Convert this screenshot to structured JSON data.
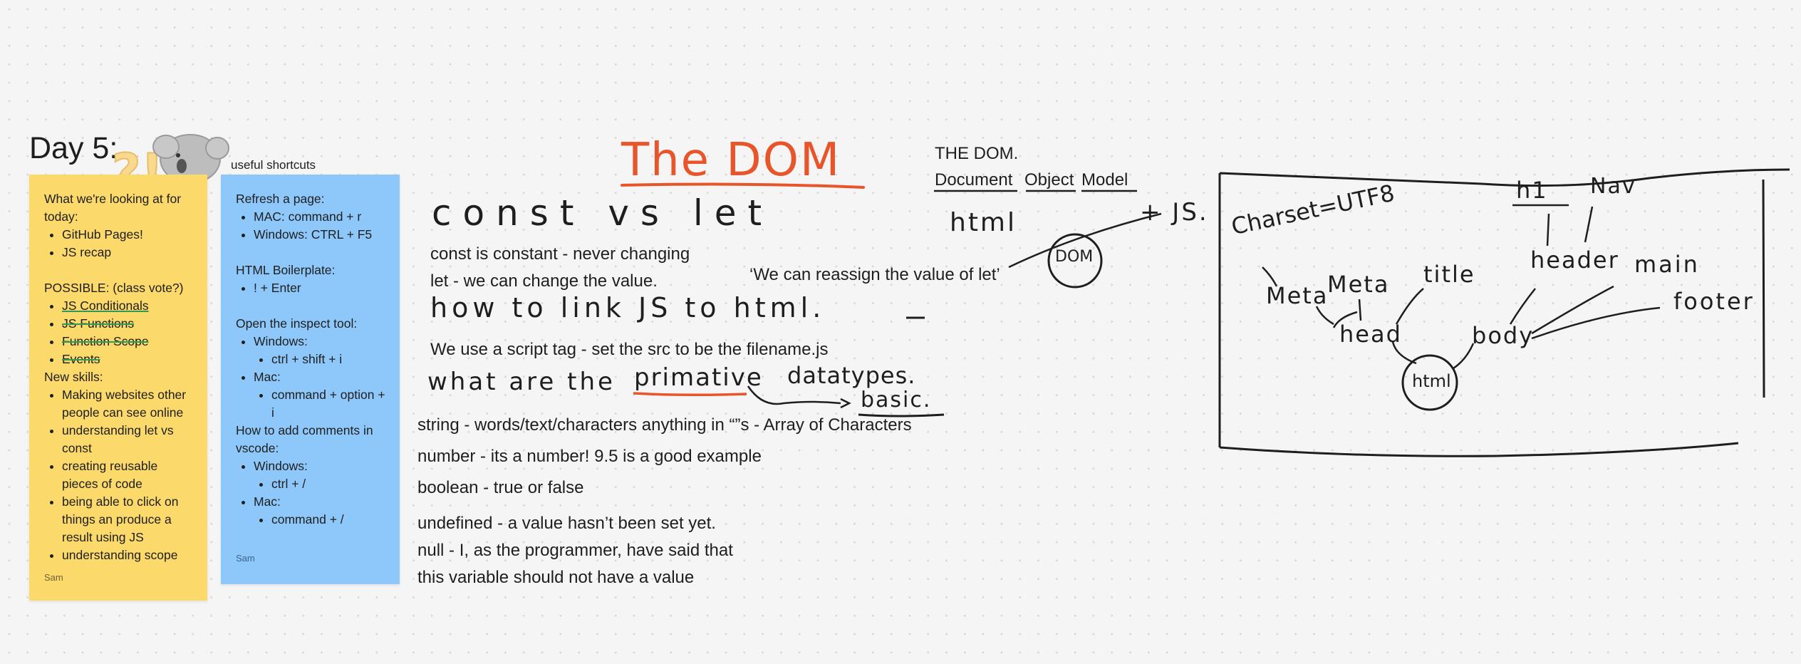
{
  "frame": {
    "title": "Day 5:"
  },
  "shortcuts_label": "useful shortcuts",
  "yellow_note": {
    "intro": "What we're looking at for today:",
    "today_items": [
      "GitHub Pages!",
      "JS recap"
    ],
    "possible_heading": "POSSIBLE: (class vote?)",
    "possible_items": [
      "JS Conditionals",
      "JS Functions",
      "Function Scope",
      "Events"
    ],
    "skills_heading": "New skills:",
    "skills_items": [
      "Making websites other people can see online",
      "understanding let vs const",
      "creating reusable pieces of code",
      "being able to click on things an produce a result using JS",
      "understanding scope"
    ],
    "author": "Sam"
  },
  "blue_note": {
    "refresh_heading": "Refresh a page:",
    "refresh_items": [
      "MAC: command + r",
      "Windows: CTRL + F5"
    ],
    "boilerplate_heading": "HTML Boilerplate:",
    "boilerplate_items": [
      "! + Enter"
    ],
    "inspect_heading": "Open the inspect tool:",
    "inspect_windows": "Windows:",
    "inspect_windows_keys": "ctrl + shift + i",
    "inspect_mac": "Mac:",
    "inspect_mac_keys": "command + option + i",
    "comments_heading": "How to add comments in vscode:",
    "comments_windows": "Windows:",
    "comments_windows_keys": "ctrl + /",
    "comments_mac": "Mac:",
    "comments_mac_keys": "command + /",
    "author": "Sam"
  },
  "dom_section": {
    "title": "The DOM",
    "handwriting_const": "const vs let",
    "const_line": "const is constant - never changing",
    "let_line": "let - we can change the value.",
    "reassign_quote": "‘We can reassign the value of let’",
    "handwriting_link": "how to link JS to html.",
    "script_line": "We use a script tag - set the src to be the filename.js",
    "handwriting_primitive_1": "what are the",
    "handwriting_primitive_word": "primative",
    "handwriting_primitive_2": "datatypes.",
    "handwriting_basic": "basic.",
    "string_line": "string - words/text/characters anything in “”s - Array of Characters",
    "number_line": "number - its a number! 9.5 is a good example",
    "boolean_line": "boolean - true or false",
    "undefined_line": "undefined -  a value hasn’t been set yet.",
    "null_line_1": "null - I, as the programmer, have said that",
    "null_line_2": "this variable should not have a value"
  },
  "dom_acronym": {
    "line1": "THE DOM.",
    "word1": "Document",
    "word2": "Object",
    "word3": "Model"
  },
  "dom_sketch": {
    "html_label": "html",
    "dom_circle": "DOM",
    "plus_js": "+ JS."
  },
  "tree_diagram": {
    "charset": "Charset=UTF8",
    "meta1": "Meta",
    "meta2": "Meta",
    "title": "title",
    "head": "head",
    "html": "html",
    "body": "body",
    "header": "header",
    "h1": "h1",
    "nav": "Nav",
    "main": "main",
    "footer": "footer"
  },
  "colors": {
    "yellow_note": "#fbd96b",
    "blue_note": "#8ec8fb",
    "title_accent": "#e8552b",
    "strike_green": "#2e9b54",
    "ink": "#1e1e1e"
  }
}
